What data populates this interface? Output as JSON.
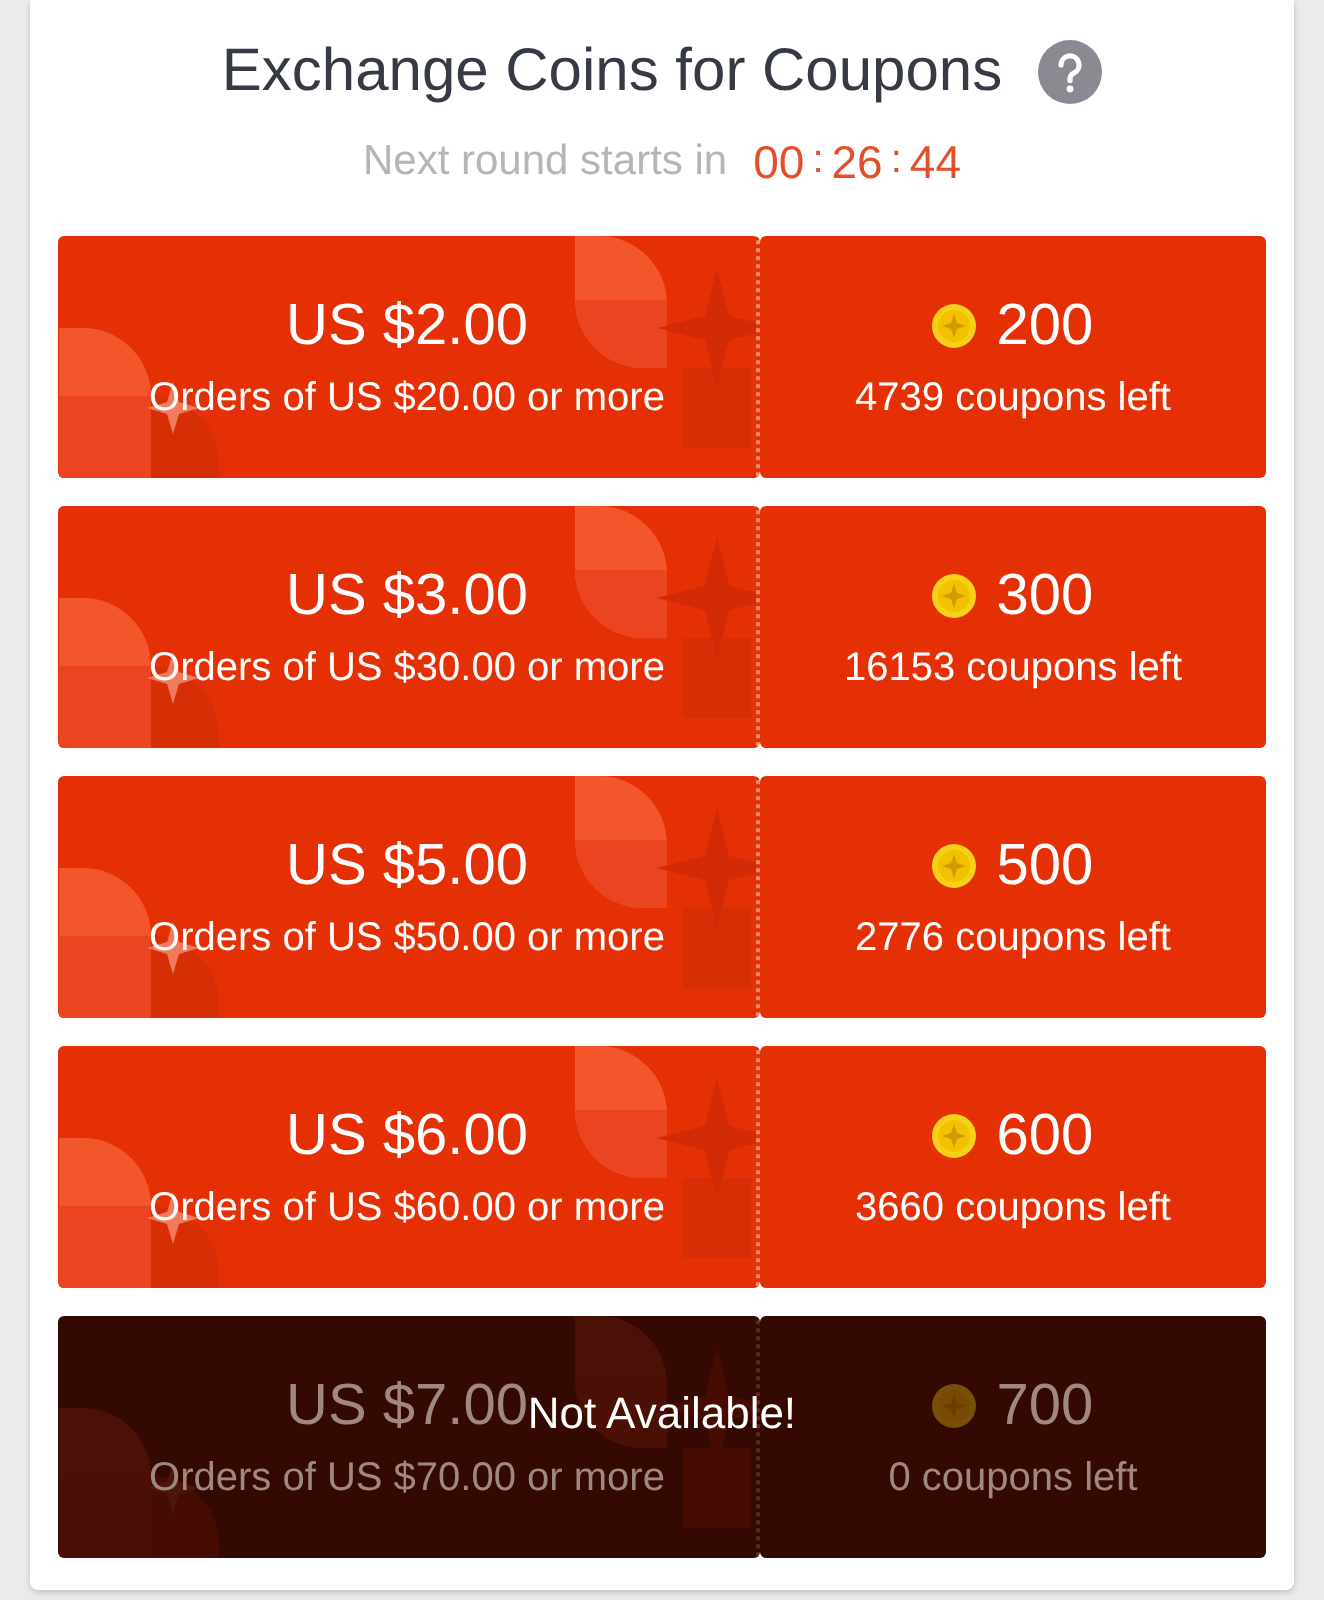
{
  "header": {
    "title": "Exchange Coins for Coupons",
    "countdown_label": "Next round starts in",
    "countdown": [
      {
        "kind": "digits",
        "text": "00"
      },
      {
        "kind": "separator",
        "text": ":"
      },
      {
        "kind": "digits",
        "text": "26"
      },
      {
        "kind": "separator",
        "text": ":"
      },
      {
        "kind": "digits",
        "text": "44"
      }
    ]
  },
  "coupons": [
    {
      "value": "US $2.00",
      "condition": "Orders of US $20.00 or more",
      "coins": "200",
      "remaining": "4739 coupons left",
      "available": true
    },
    {
      "value": "US $3.00",
      "condition": "Orders of US $30.00 or more",
      "coins": "300",
      "remaining": "16153 coupons left",
      "available": true
    },
    {
      "value": "US $5.00",
      "condition": "Orders of US $50.00 or more",
      "coins": "500",
      "remaining": "2776 coupons left",
      "available": true
    },
    {
      "value": "US $6.00",
      "condition": "Orders of US $60.00 or more",
      "coins": "600",
      "remaining": "3660 coupons left",
      "available": true
    },
    {
      "value": "US $7.00",
      "condition": "Orders of US $70.00 or more",
      "coins": "700",
      "remaining": "0 coupons left",
      "available": false,
      "overlay_text": "Not Available!"
    }
  ]
}
